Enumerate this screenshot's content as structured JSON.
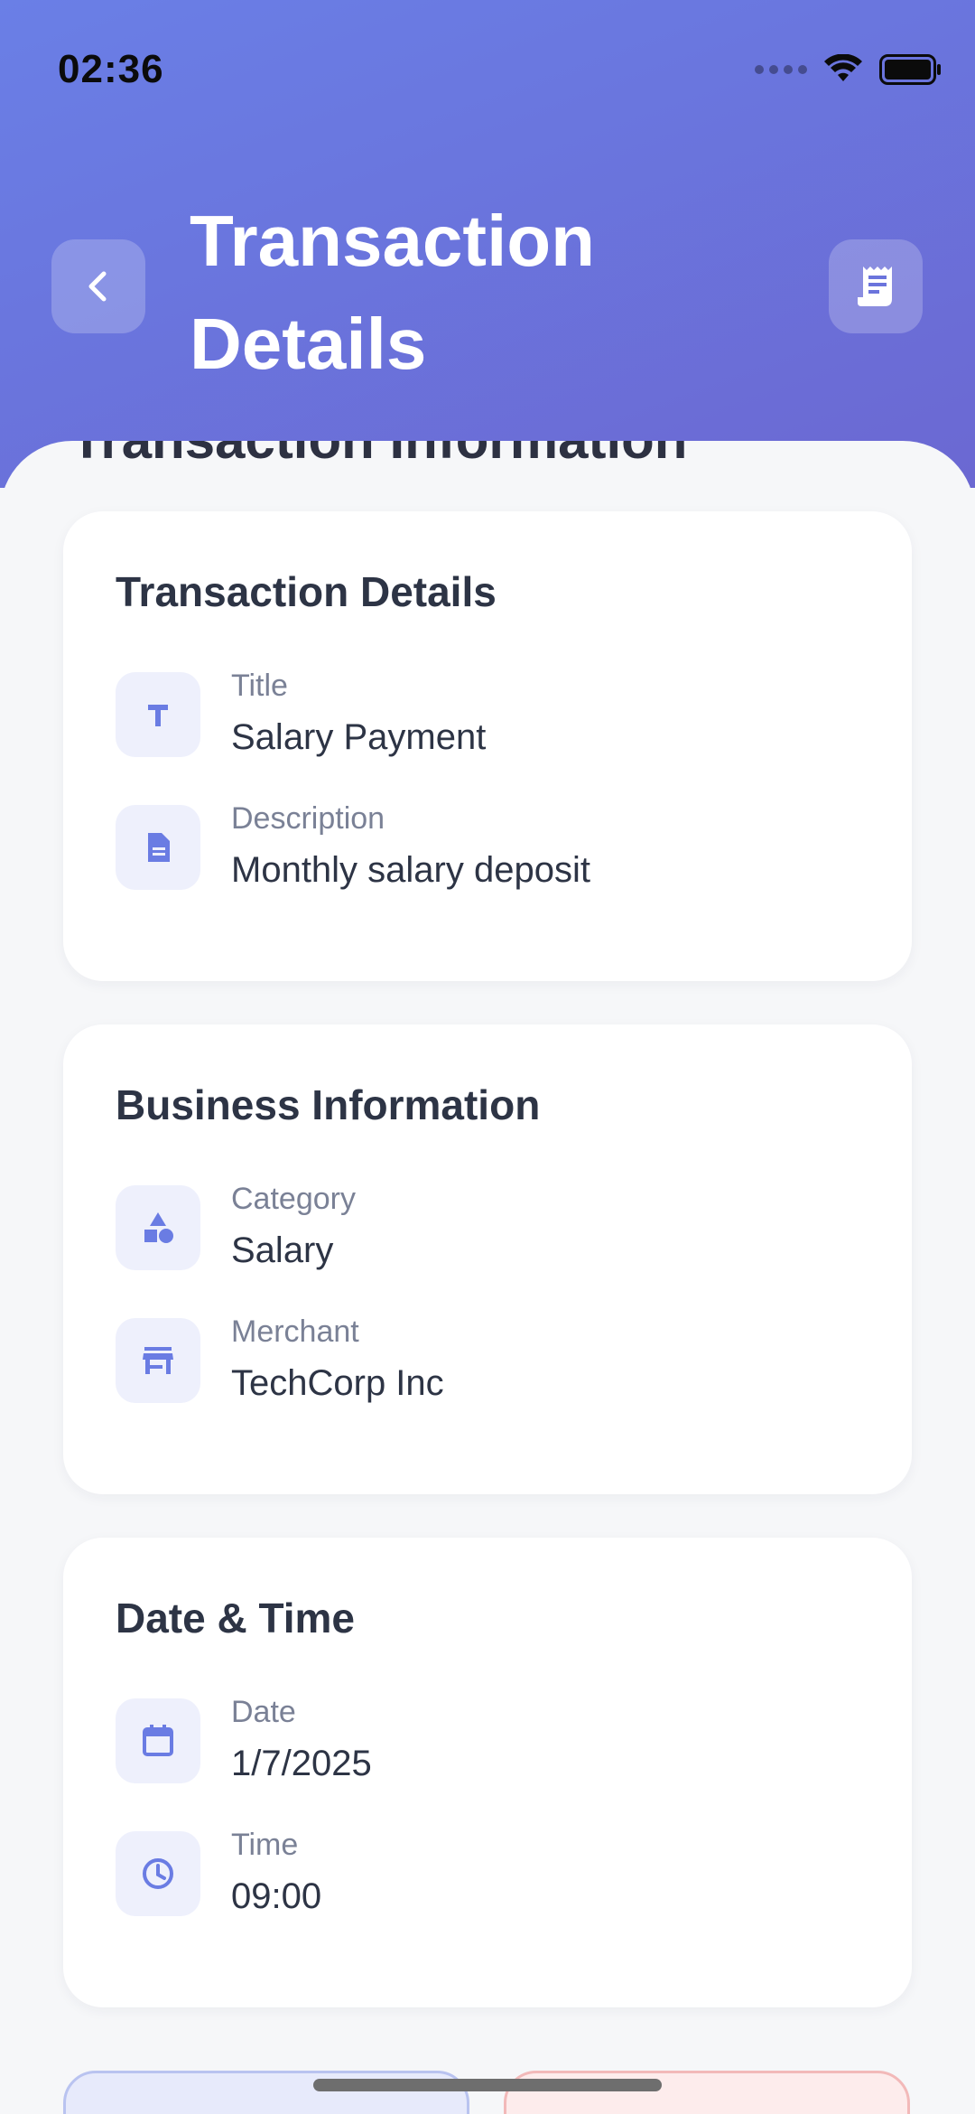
{
  "status_bar": {
    "time": "02:36"
  },
  "header": {
    "title": "Transaction Details"
  },
  "partial_section_heading": "Transaction Information",
  "cards": [
    {
      "title": "Transaction Details",
      "rows": [
        {
          "label": "Title",
          "value": "Salary Payment",
          "icon": "text-t-icon"
        },
        {
          "label": "Description",
          "value": "Monthly salary deposit",
          "icon": "document-icon"
        }
      ]
    },
    {
      "title": "Business Information",
      "rows": [
        {
          "label": "Category",
          "value": "Salary",
          "icon": "category-shapes-icon"
        },
        {
          "label": "Merchant",
          "value": "TechCorp Inc",
          "icon": "store-icon"
        }
      ]
    },
    {
      "title": "Date & Time",
      "rows": [
        {
          "label": "Date",
          "value": "1/7/2025",
          "icon": "calendar-icon"
        },
        {
          "label": "Time",
          "value": "09:00",
          "icon": "clock-icon"
        }
      ]
    }
  ],
  "colors": {
    "header_gradient_start": "#6a7fe6",
    "header_gradient_end": "#6b68d2",
    "icon_accent": "#6a7ce3",
    "background": "#f6f7f9"
  }
}
